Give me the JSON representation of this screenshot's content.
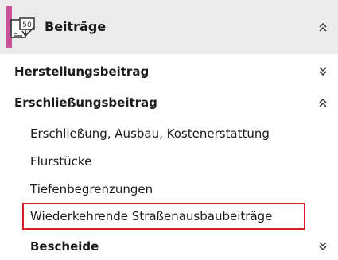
{
  "header": {
    "title": "Beiträge",
    "icon": "fee-document-50-icon",
    "icon_text": "50",
    "accent_color": "#c8559a",
    "state": "expanded"
  },
  "sections": [
    {
      "label": "Herstellungsbeitrag",
      "state": "collapsed"
    },
    {
      "label": "Erschließungsbeitrag",
      "state": "expanded"
    }
  ],
  "sub_items": [
    {
      "label": "Erschließung, Ausbau, Kostenerstattung"
    },
    {
      "label": "Flurstücke"
    },
    {
      "label": "Tiefenbegrenzungen"
    },
    {
      "label": "Wiederkehrende Straßenausbaubeiträge",
      "highlighted": true
    }
  ],
  "footer_section": {
    "label": "Bescheide",
    "state": "collapsed"
  },
  "highlight_color": "#d21c26"
}
